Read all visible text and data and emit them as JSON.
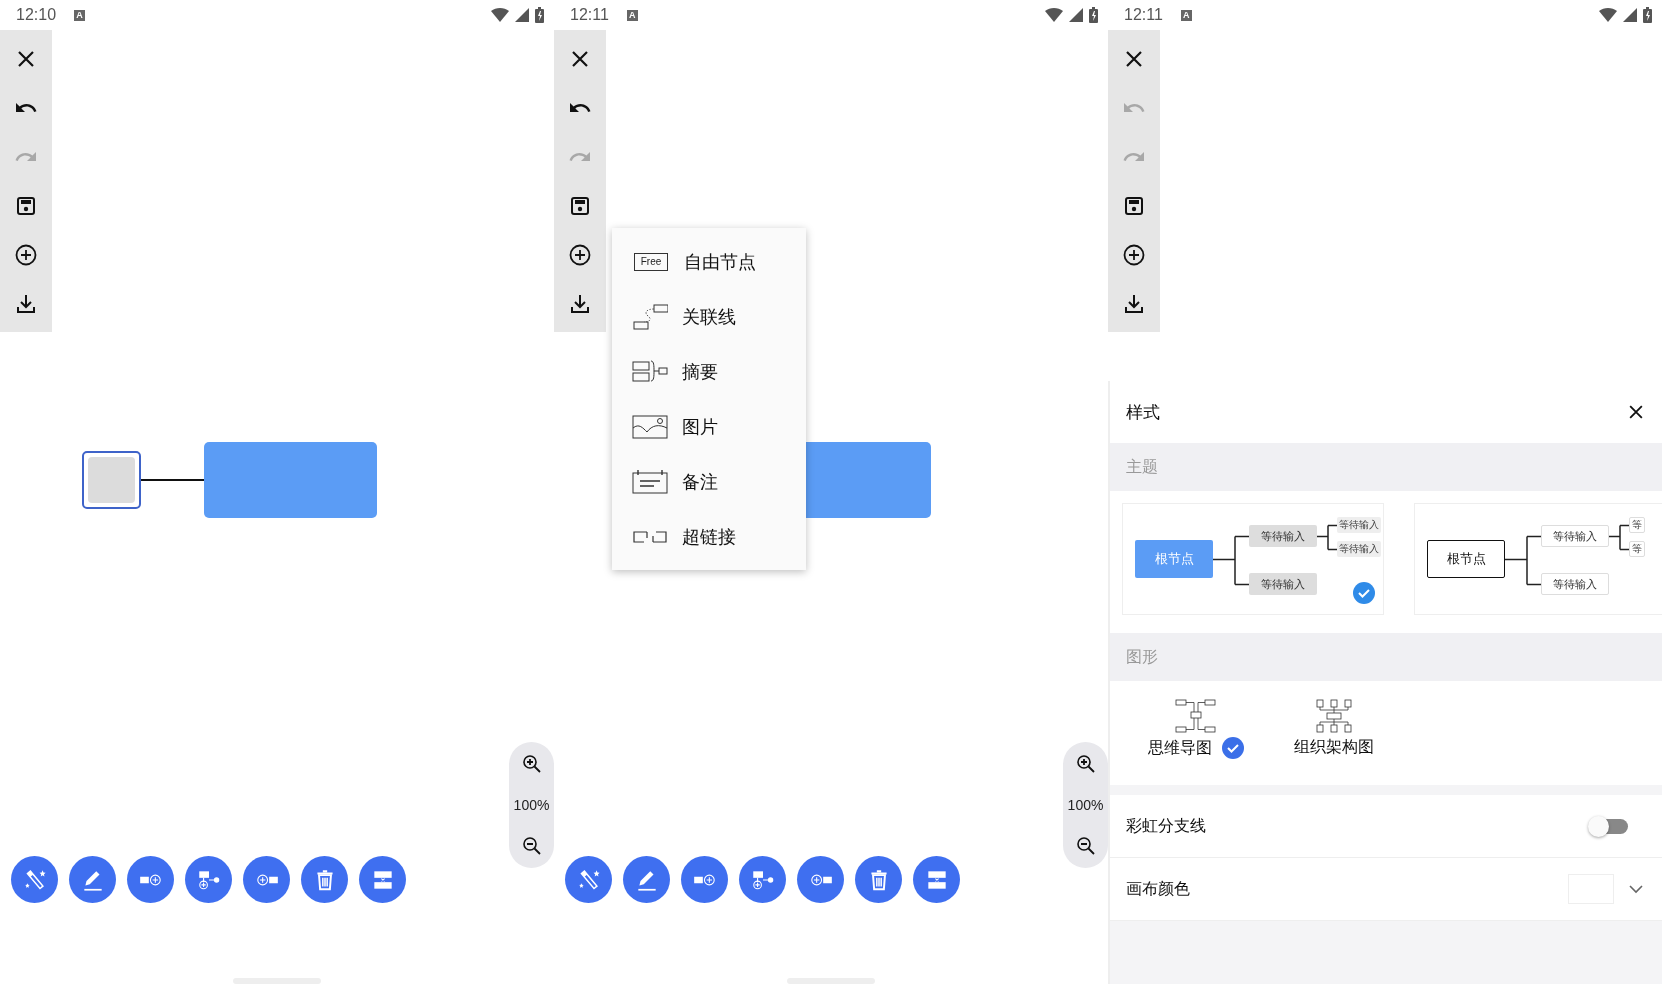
{
  "screens": [
    {
      "status_bar": {
        "time": "12:10",
        "notification": "A"
      },
      "toolbar": [
        {
          "kind": "close",
          "disabled": false
        },
        {
          "kind": "undo",
          "disabled": false
        },
        {
          "kind": "redo",
          "disabled": true
        },
        {
          "kind": "save",
          "disabled": false
        },
        {
          "kind": "add",
          "disabled": false
        },
        {
          "kind": "download",
          "disabled": false
        }
      ],
      "canvas": {
        "nodes": [
          {
            "kind": "root",
            "selected": true
          },
          {
            "kind": "topic",
            "selected": false
          }
        ]
      },
      "zoom": {
        "label": "100%"
      },
      "actions": [
        {
          "kind": "magic"
        },
        {
          "kind": "edit"
        },
        {
          "kind": "add-child"
        },
        {
          "kind": "add-sibling"
        },
        {
          "kind": "add-parent"
        },
        {
          "kind": "delete"
        },
        {
          "kind": "detach"
        }
      ]
    },
    {
      "status_bar": {
        "time": "12:11",
        "notification": "A"
      },
      "toolbar": [
        {
          "kind": "close",
          "disabled": false
        },
        {
          "kind": "undo",
          "disabled": false
        },
        {
          "kind": "redo",
          "disabled": true
        },
        {
          "kind": "save",
          "disabled": false
        },
        {
          "kind": "add",
          "disabled": false
        },
        {
          "kind": "download",
          "disabled": false
        }
      ],
      "canvas": {
        "nodes": [
          {
            "kind": "topic",
            "selected": false
          }
        ]
      },
      "insert_menu": [
        {
          "kind": "free",
          "icon_text": "Free",
          "label": "自由节点"
        },
        {
          "kind": "relation",
          "label": "关联线"
        },
        {
          "kind": "summary",
          "label": "摘要"
        },
        {
          "kind": "image",
          "label": "图片"
        },
        {
          "kind": "note",
          "label": "备注"
        },
        {
          "kind": "link",
          "label": "超链接"
        }
      ],
      "zoom": {
        "label": "100%"
      },
      "actions": [
        {
          "kind": "magic"
        },
        {
          "kind": "edit"
        },
        {
          "kind": "add-child"
        },
        {
          "kind": "add-sibling"
        },
        {
          "kind": "add-parent"
        },
        {
          "kind": "delete"
        },
        {
          "kind": "detach"
        }
      ]
    },
    {
      "status_bar": {
        "time": "12:11",
        "notification": "A"
      },
      "toolbar": [
        {
          "kind": "close",
          "disabled": false
        },
        {
          "kind": "undo",
          "disabled": true
        },
        {
          "kind": "redo",
          "disabled": true
        },
        {
          "kind": "save",
          "disabled": false
        },
        {
          "kind": "add",
          "disabled": false
        },
        {
          "kind": "download",
          "disabled": false
        }
      ],
      "style_sheet": {
        "title": "样式",
        "theme": {
          "title": "主题",
          "options": [
            {
              "kind": "filled",
              "selected": true,
              "root": "根节点",
              "children": [
                "等待输入",
                "等待输入"
              ],
              "grandchildren": [
                "等待输入",
                "等待输入"
              ]
            },
            {
              "kind": "outline",
              "selected": false,
              "root": "根节点",
              "children": [
                "等待输入",
                "等待输入"
              ],
              "grandchildren": [
                "等",
                "等"
              ]
            }
          ]
        },
        "shape": {
          "title": "图形",
          "options": [
            {
              "kind": "mindmap",
              "label": "思维导图",
              "selected": true
            },
            {
              "kind": "org",
              "label": "组织架构图",
              "selected": false
            }
          ]
        },
        "settings": [
          {
            "kind": "toggle",
            "label": "彩虹分支线",
            "on": false
          },
          {
            "kind": "color",
            "label": "画布颜色",
            "color": "#ffffff"
          }
        ]
      }
    }
  ]
}
